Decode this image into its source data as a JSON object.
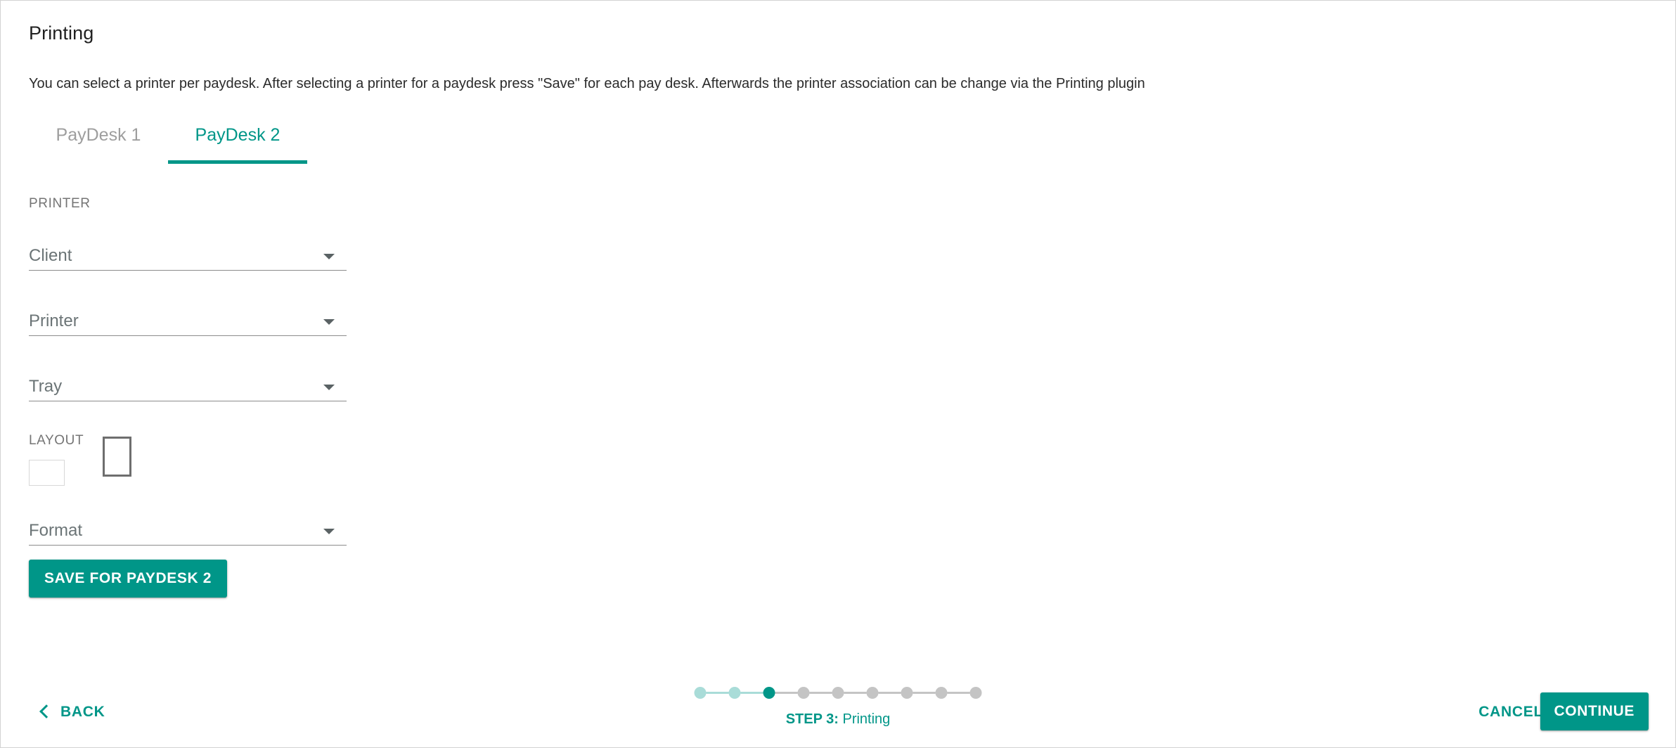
{
  "card": {
    "title": "Printing",
    "description": "You can select a printer per paydesk. After selecting a printer for a paydesk press \"Save\" for each pay desk. Afterwards the printer association can be change via the Printing plugin"
  },
  "tabs": [
    {
      "label": "PayDesk 1",
      "active": false
    },
    {
      "label": "PayDesk 2",
      "active": true
    }
  ],
  "printer_section": {
    "label": "PRINTER",
    "fields": [
      {
        "name": "client",
        "value": "Client",
        "icon": "chevron-down-icon"
      },
      {
        "name": "printer",
        "value": "Printer",
        "icon": "chevron-down-icon"
      },
      {
        "name": "tray",
        "value": "Tray",
        "icon": "chevron-down-icon"
      }
    ]
  },
  "layout_section": {
    "label": "LAYOUT",
    "options": [
      {
        "name": "landscape",
        "selected": false
      },
      {
        "name": "portrait",
        "selected": true
      }
    ],
    "format_field": {
      "name": "format",
      "value": "Format",
      "icon": "chevron-down-icon"
    }
  },
  "save_button": {
    "label": "SAVE FOR PAYDESK 2"
  },
  "footer": {
    "back_label": "BACK",
    "back_icon": "chevron-left-icon",
    "cancel_label": "CANCEL",
    "continue_label": "CONTINUE",
    "step_prefix": "STEP 3:",
    "step_name": "Printing",
    "stepper": {
      "total": 9,
      "current": 3,
      "states": [
        "done",
        "done",
        "active",
        "todo",
        "todo",
        "todo",
        "todo",
        "todo",
        "todo"
      ]
    }
  },
  "colors": {
    "accent": "#009688",
    "accent_light": "#a9dcd8",
    "inactive": "#c4c4c4",
    "tab_inactive": "#9e9e9e",
    "label_gray": "#757575",
    "field_text": "#6b7476"
  }
}
